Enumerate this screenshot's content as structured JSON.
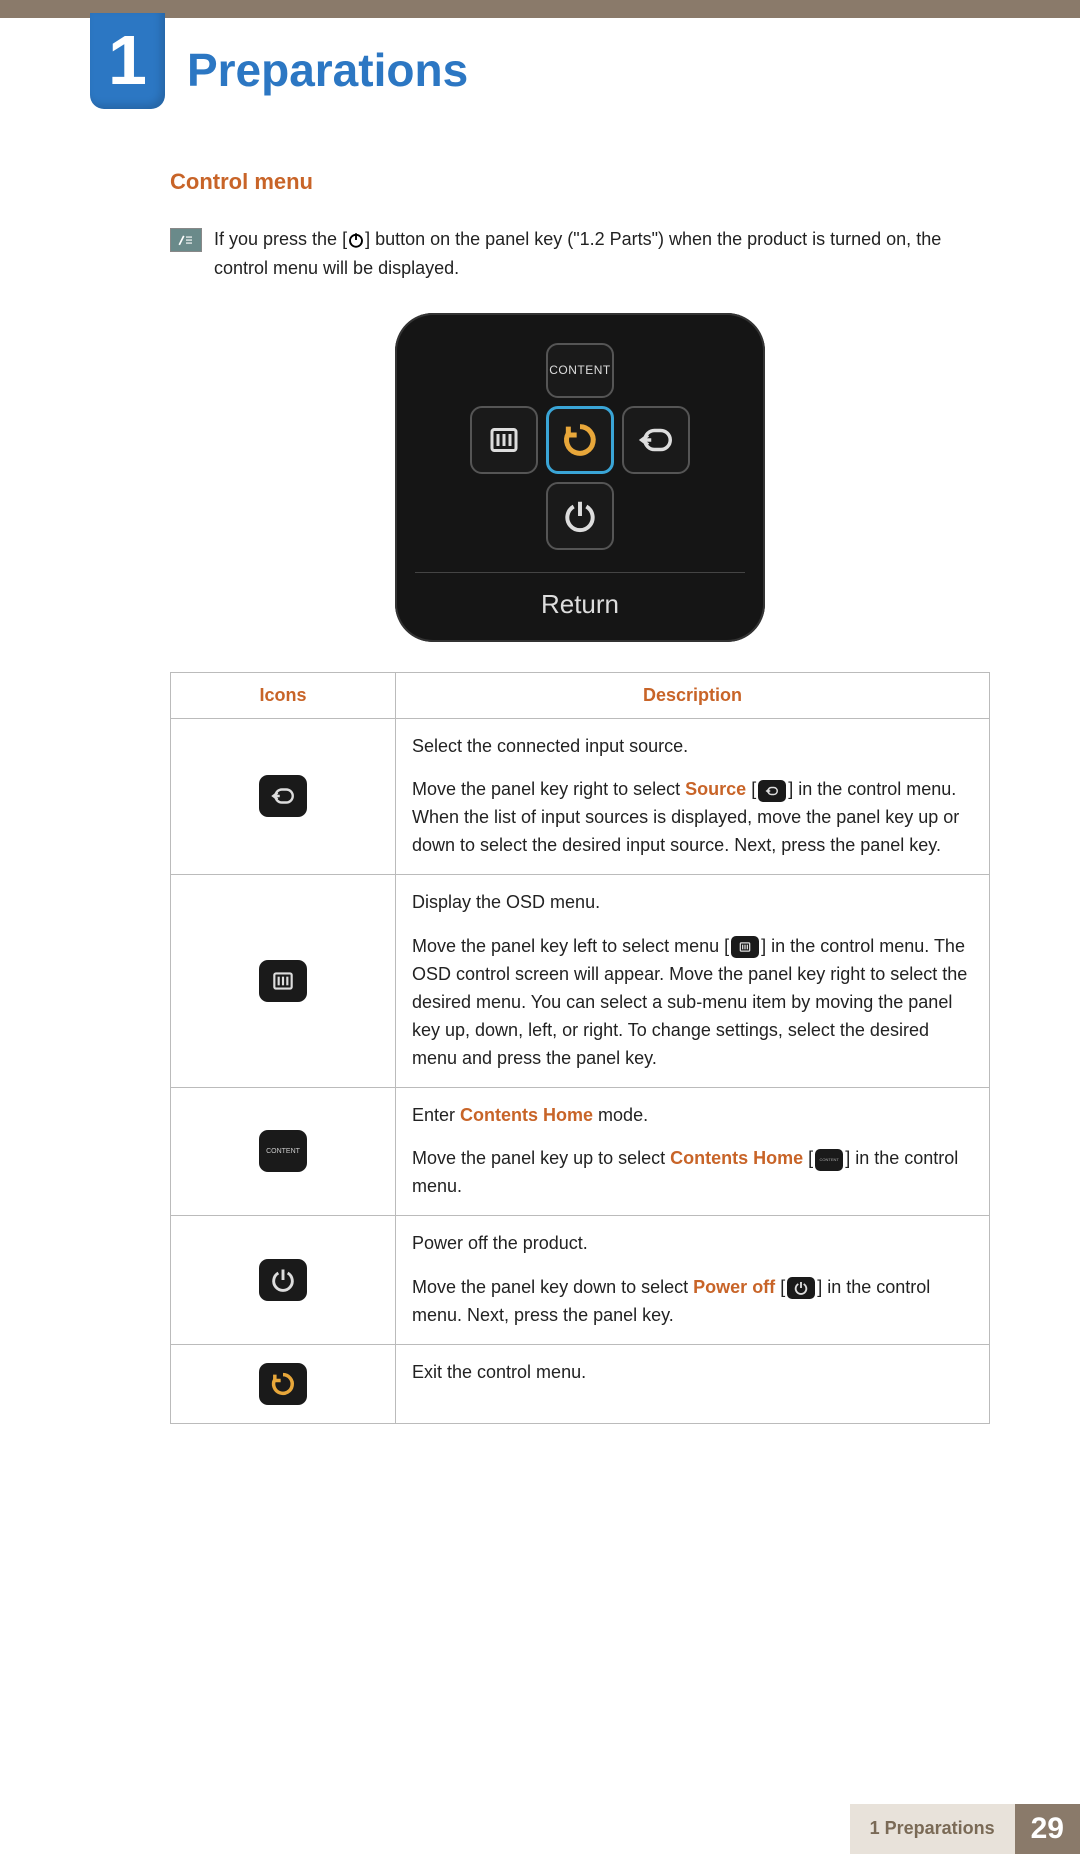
{
  "chapter": {
    "number": "1",
    "title": "Preparations"
  },
  "section": {
    "title": "Control menu"
  },
  "note": {
    "text_pre": "If you press the [",
    "text_post": "] button on the panel key (\"1.2 Parts\") when the product is turned on, the control menu will be displayed."
  },
  "device_menu": {
    "content_label": "CONTENT",
    "footer_label": "Return"
  },
  "table": {
    "headers": {
      "icons": "Icons",
      "description": "Description"
    },
    "rows": {
      "source": {
        "line1": "Select the connected input source.",
        "line2_pre": "Move the panel key right to select ",
        "line2_hl": "Source",
        "line2_post_icon": " in the control menu. When the list of input sources is displayed, move the panel key up or down to select the desired input source. Next, press the panel key."
      },
      "menu": {
        "line1": "Display the OSD menu.",
        "line2_pre": "Move the panel key left to select menu [",
        "line2_post": "] in the control menu. The OSD control screen will appear. Move the panel key right to select the desired menu. You can select a sub-menu item by moving the panel key up, down, left, or right. To change settings, select the desired menu and press the panel key."
      },
      "content": {
        "line1_pre": "Enter ",
        "line1_hl": "Contents Home",
        "line1_post": " mode.",
        "line2_pre": "Move the panel key up to select ",
        "line2_hl": "Contents Home",
        "line2_post": " in the control menu."
      },
      "power": {
        "line1": "Power off the product.",
        "line2_pre": "Move the panel key down to select ",
        "line2_hl": "Power off",
        "line2_post": " in the control menu. Next, press the panel key."
      },
      "return": {
        "line1": "Exit the control menu."
      }
    }
  },
  "footer": {
    "label": "1 Preparations",
    "page": "29"
  },
  "icon_labels": {
    "content_small": "CONTENT"
  }
}
